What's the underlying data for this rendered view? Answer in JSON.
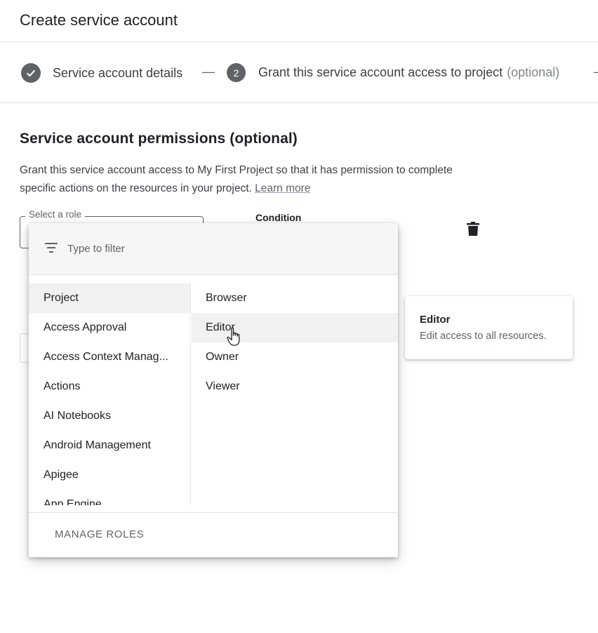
{
  "header": {
    "title": "Create service account"
  },
  "stepper": {
    "step1_label": "Service account details",
    "separator": "—",
    "step2_number": "2",
    "step2_label": "Grant this service account access to project",
    "step2_optional": "(optional)"
  },
  "section": {
    "title": "Service account permissions (optional)",
    "description": "Grant this service account access to My First Project so that it has permission to complete specific actions on the resources in your project.",
    "learn_more": "Learn more"
  },
  "role_field": {
    "label": "Select a role"
  },
  "condition": {
    "label": "Condition"
  },
  "menu": {
    "filter_placeholder": "Type to filter",
    "categories": [
      {
        "label": "Project"
      },
      {
        "label": "Access Approval"
      },
      {
        "label": "Access Context Manag..."
      },
      {
        "label": "Actions"
      },
      {
        "label": "AI Notebooks"
      },
      {
        "label": "Android Management"
      },
      {
        "label": "Apigee"
      },
      {
        "label": "App Engine"
      }
    ],
    "roles": [
      {
        "label": "Browser"
      },
      {
        "label": "Editor"
      },
      {
        "label": "Owner"
      },
      {
        "label": "Viewer"
      }
    ],
    "manage_roles": "MANAGE ROLES"
  },
  "tooltip": {
    "title": "Editor",
    "description": "Edit access to all resources."
  },
  "colors": {
    "step_circle": "#5f6368",
    "selected_row": "#f1f1f1",
    "filter_bar": "#f6f6f6"
  }
}
